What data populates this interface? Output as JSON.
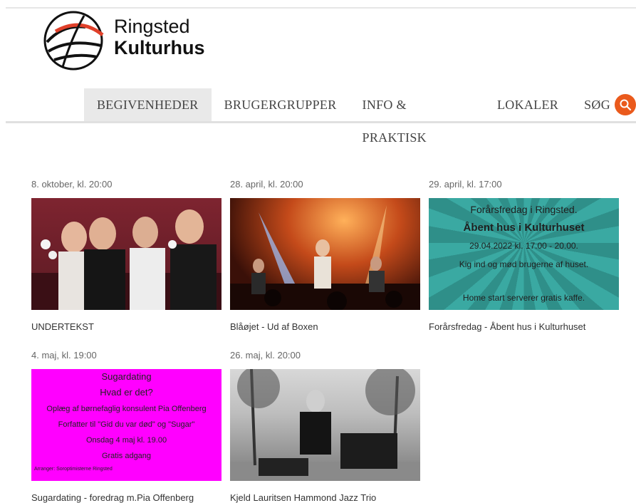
{
  "brand": {
    "line1": "Ringsted",
    "line2": "Kulturhus"
  },
  "nav": {
    "items": [
      "BEGIVENHEDER",
      "BRUGERGRUPPER",
      "INFO & PRAKTISK",
      "LOKALER"
    ],
    "search_label": "SØG",
    "accent": "#ea5a1c"
  },
  "events": [
    {
      "date": "8. oktober, kl. 20:00",
      "caption": "UNDERTEKST"
    },
    {
      "date": "28. april, kl. 20:00",
      "caption": "Blåøjet - Ud af Boxen"
    },
    {
      "date": "29. april, kl. 17:00",
      "caption": "Forårsfredag - Åbent hus i Kulturhuset",
      "poster": [
        "Forårsfredag i Ringsted.",
        "Åbent hus i Kulturhuset",
        "29.04.2022 kl. 17.00 - 20.00.",
        "Kig ind og mød brugerne af huset.",
        "Home start serverer gratis kaffe."
      ]
    },
    {
      "date": "4. maj, kl. 19:00",
      "caption": "Sugardating - foredrag m.Pia Offenberg",
      "poster": [
        "Sugardating",
        "Hvad er det?",
        "Oplæg af børnefaglig konsulent Pia Offenberg",
        "Forfatter til \"Gid du var død\" og \"Sugar\"",
        "Onsdag 4 maj kl. 19.00",
        "Gratis adgang",
        "Arranger: Soroptimisterne Ringsted"
      ]
    },
    {
      "date": "26. maj, kl. 20:00",
      "caption": "Kjeld Lauritsen Hammond Jazz Trio"
    }
  ]
}
